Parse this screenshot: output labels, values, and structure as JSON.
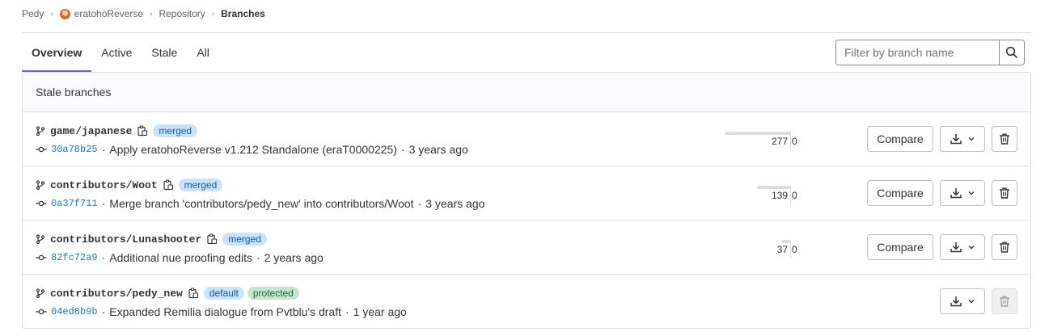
{
  "breadcrumb": {
    "items": [
      "Pedy",
      "eratohoReverse",
      "Repository",
      "Branches"
    ]
  },
  "tabs": [
    {
      "label": "Overview",
      "active": true
    },
    {
      "label": "Active",
      "active": false
    },
    {
      "label": "Stale",
      "active": false
    },
    {
      "label": "All",
      "active": false
    }
  ],
  "filter": {
    "placeholder": "Filter by branch name",
    "value": ""
  },
  "panel": {
    "title": "Stale branches"
  },
  "actions": {
    "compare_label": "Compare"
  },
  "branches": [
    {
      "name": "game/japanese",
      "badges": [
        {
          "label": "merged",
          "kind": "info"
        }
      ],
      "sha": "30a78b25",
      "message": "Apply eratohoReverse v1.212 Standalone (eraT0000225)",
      "time": "3 years ago",
      "behind": "277",
      "ahead": "0",
      "behind_fraction": 1.0,
      "compare": true,
      "delete_enabled": true
    },
    {
      "name": "contributors/Woot",
      "badges": [
        {
          "label": "merged",
          "kind": "info"
        }
      ],
      "sha": "0a37f711",
      "message": "Merge branch 'contributors/pedy_new' into contributors/Woot",
      "time": "3 years ago",
      "behind": "139",
      "ahead": "0",
      "behind_fraction": 0.5,
      "compare": true,
      "delete_enabled": true
    },
    {
      "name": "contributors/Lunashooter",
      "badges": [
        {
          "label": "merged",
          "kind": "info"
        }
      ],
      "sha": "82fc72a9",
      "message": "Additional nue proofing edits",
      "time": "2 years ago",
      "behind": "37",
      "ahead": "0",
      "behind_fraction": 0.13,
      "compare": true,
      "delete_enabled": true
    },
    {
      "name": "contributors/pedy_new",
      "badges": [
        {
          "label": "default",
          "kind": "info"
        },
        {
          "label": "protected",
          "kind": "success"
        }
      ],
      "sha": "04ed8b9b",
      "message": "Expanded Remilia dialogue from Pvtblu's draft",
      "time": "1 year ago",
      "behind": "",
      "ahead": "",
      "behind_fraction": 0,
      "compare": false,
      "delete_enabled": false
    }
  ],
  "colors": {
    "accent": "#6666c4",
    "link": "#1f75cb",
    "badge_info_bg": "#cbe2f9",
    "badge_success_bg": "#c3e6cd"
  }
}
